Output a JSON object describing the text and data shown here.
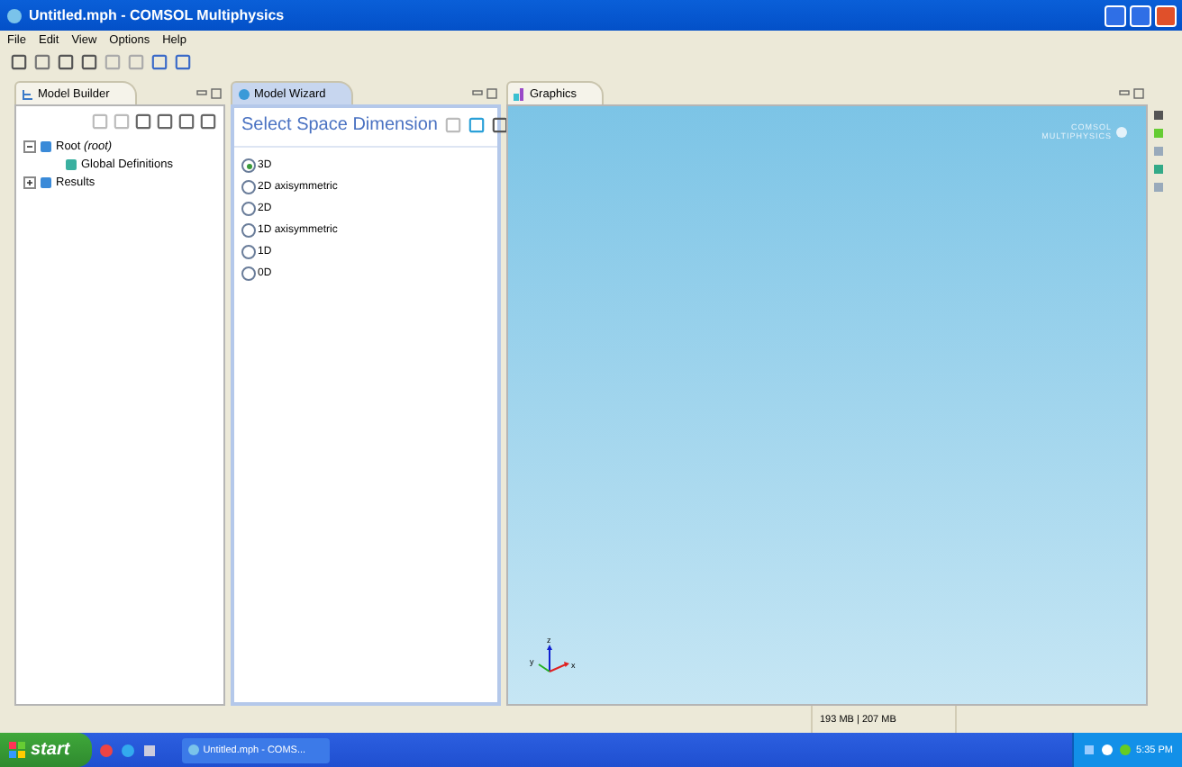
{
  "window": {
    "title": "Untitled.mph - COMSOL Multiphysics"
  },
  "menu": [
    "File",
    "Edit",
    "View",
    "Options",
    "Help"
  ],
  "model_builder": {
    "title": "Model Builder",
    "selected": false,
    "tree": [
      {
        "label": "Root",
        "note": "(root)",
        "expanded": true,
        "children": [
          {
            "label": "Global Definitions"
          }
        ]
      },
      {
        "label": "Results",
        "expanded": false
      }
    ]
  },
  "model_wizard": {
    "title": "Model Wizard",
    "selected": true,
    "heading": "Select Space Dimension",
    "options": [
      {
        "label": "3D",
        "selected": true
      },
      {
        "label": "2D axisymmetric",
        "selected": false
      },
      {
        "label": "2D",
        "selected": false
      },
      {
        "label": "1D axisymmetric",
        "selected": false
      },
      {
        "label": "1D",
        "selected": false
      },
      {
        "label": "0D",
        "selected": false
      }
    ]
  },
  "graphics": {
    "title": "Graphics",
    "selected": false,
    "logo": [
      "COMSOL",
      "MULTIPHYSICS"
    ],
    "axes": [
      "z",
      "y",
      "x"
    ]
  },
  "status_bar": {
    "memory": "193 MB | 207 MB"
  },
  "taskbar": {
    "start": "start",
    "task": "Untitled.mph - COMS...",
    "clock": "5:35 PM"
  }
}
